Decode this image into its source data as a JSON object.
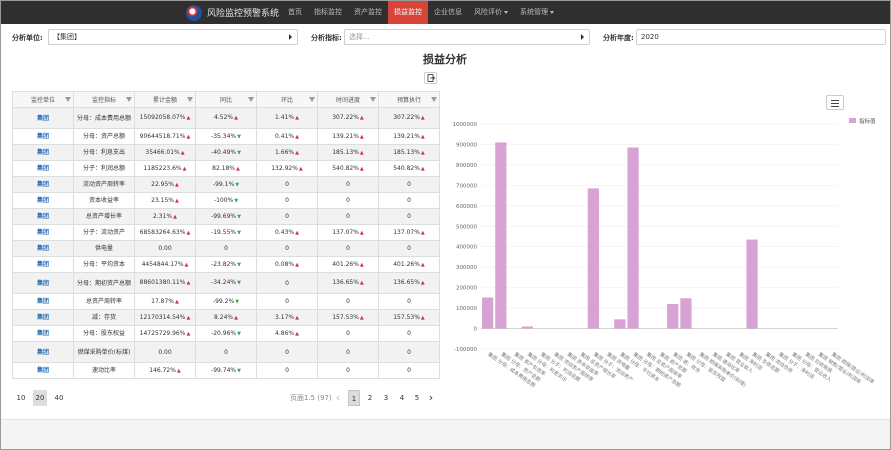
{
  "app": {
    "title": "风险监控预警系统",
    "nav": [
      {
        "label": "首页",
        "active": false,
        "dropdown": false
      },
      {
        "label": "指标监控",
        "active": false,
        "dropdown": false
      },
      {
        "label": "资产监控",
        "active": false,
        "dropdown": false
      },
      {
        "label": "损益监控",
        "active": true,
        "dropdown": false
      },
      {
        "label": "企业信息",
        "active": false,
        "dropdown": false
      },
      {
        "label": "风险评价",
        "active": false,
        "dropdown": true
      },
      {
        "label": "系统管理",
        "active": false,
        "dropdown": true
      }
    ],
    "accent_color": "#d6443a",
    "nav_bg_color": "#2f2f2f"
  },
  "filters": {
    "unit_label": "分析单位:",
    "unit_value": "【集团】",
    "indicator_label": "分析指标:",
    "indicator_placeholder": "选择...",
    "year_label": "分析年度:",
    "year_value": "2020"
  },
  "page": {
    "title": "损益分析",
    "export_icon": "export-icon"
  },
  "table": {
    "columns": [
      "监控单位",
      "监控指标",
      "累计金额",
      "同比",
      "环比",
      "时间进度",
      "预算执行"
    ],
    "rows": [
      {
        "unit": "集团",
        "indicator": "分母：成本费用总额",
        "amount": "15092058.07%",
        "amount_trend": "up",
        "yoy": "4.52%",
        "yoy_trend": "up",
        "mom": "1.41%",
        "mom_trend": "up",
        "progress": "307.22%",
        "progress_trend": "up",
        "budget": "307.22%",
        "budget_trend": "up"
      },
      {
        "unit": "集团",
        "indicator": "分母：资产总额",
        "amount": "90644518.71%",
        "amount_trend": "up",
        "yoy": "-35.34%",
        "yoy_trend": "down",
        "mom": "0.41%",
        "mom_trend": "up",
        "progress": "139.21%",
        "progress_trend": "up",
        "budget": "139.21%",
        "budget_trend": "up"
      },
      {
        "unit": "集团",
        "indicator": "分母：利息支出",
        "amount": "35466.01%",
        "amount_trend": "up",
        "yoy": "-40.49%",
        "yoy_trend": "down",
        "mom": "1.66%",
        "mom_trend": "up",
        "progress": "185.13%",
        "progress_trend": "up",
        "budget": "185.13%",
        "budget_trend": "up"
      },
      {
        "unit": "集团",
        "indicator": "分子：利润总额",
        "amount": "1185223.6%",
        "amount_trend": "up",
        "yoy": "82.18%",
        "yoy_trend": "up",
        "mom": "132.92%",
        "mom_trend": "up",
        "progress": "540.82%",
        "progress_trend": "up",
        "budget": "540.82%",
        "budget_trend": "up"
      },
      {
        "unit": "集团",
        "indicator": "流动资产周转率",
        "amount": "22.95%",
        "amount_trend": "up",
        "yoy": "-99.1%",
        "yoy_trend": "down",
        "mom": "0",
        "mom_trend": "",
        "progress": "0",
        "progress_trend": "",
        "budget": "0",
        "budget_trend": ""
      },
      {
        "unit": "集团",
        "indicator": "资本收益率",
        "amount": "23.15%",
        "amount_trend": "up",
        "yoy": "-100%",
        "yoy_trend": "down",
        "mom": "0",
        "mom_trend": "",
        "progress": "0",
        "progress_trend": "",
        "budget": "0",
        "budget_trend": ""
      },
      {
        "unit": "集团",
        "indicator": "总资产增长率",
        "amount": "2.31%",
        "amount_trend": "up",
        "yoy": "-99.69%",
        "yoy_trend": "down",
        "mom": "0",
        "mom_trend": "",
        "progress": "0",
        "progress_trend": "",
        "budget": "0",
        "budget_trend": ""
      },
      {
        "unit": "集团",
        "indicator": "分子：流动资产",
        "amount": "68583264.63%",
        "amount_trend": "up",
        "yoy": "-19.55%",
        "yoy_trend": "down",
        "mom": "0.43%",
        "mom_trend": "up",
        "progress": "137.07%",
        "progress_trend": "up",
        "budget": "137.07%",
        "budget_trend": "up"
      },
      {
        "unit": "集团",
        "indicator": "供电量",
        "amount": "0.00",
        "amount_trend": "",
        "yoy": "0",
        "yoy_trend": "",
        "mom": "0",
        "mom_trend": "",
        "progress": "0",
        "progress_trend": "",
        "budget": "0",
        "budget_trend": ""
      },
      {
        "unit": "集团",
        "indicator": "分母：平均资本",
        "amount": "4454844.17%",
        "amount_trend": "up",
        "yoy": "-23.82%",
        "yoy_trend": "down",
        "mom": "0.08%",
        "mom_trend": "up",
        "progress": "401.26%",
        "progress_trend": "up",
        "budget": "401.26%",
        "budget_trend": "up"
      },
      {
        "unit": "集团",
        "indicator": "分母：期初资产总额",
        "amount": "88601380.11%",
        "amount_trend": "up",
        "yoy": "-34.24%",
        "yoy_trend": "down",
        "mom": "0",
        "mom_trend": "",
        "progress": "136.65%",
        "progress_trend": "up",
        "budget": "136.65%",
        "budget_trend": "up"
      },
      {
        "unit": "集团",
        "indicator": "总资产周转率",
        "amount": "17.87%",
        "amount_trend": "up",
        "yoy": "-99.2%",
        "yoy_trend": "down",
        "mom": "0",
        "mom_trend": "",
        "progress": "0",
        "progress_trend": "",
        "budget": "0",
        "budget_trend": ""
      },
      {
        "unit": "集团",
        "indicator": "减：存货",
        "amount": "12170314.54%",
        "amount_trend": "up",
        "yoy": "8.24%",
        "yoy_trend": "up",
        "mom": "3.17%",
        "mom_trend": "up",
        "progress": "157.53%",
        "progress_trend": "up",
        "budget": "157.53%",
        "budget_trend": "up"
      },
      {
        "unit": "集团",
        "indicator": "分母：股东权益",
        "amount": "14725729.96%",
        "amount_trend": "up",
        "yoy": "-20.96%",
        "yoy_trend": "down",
        "mom": "4.86%",
        "mom_trend": "up",
        "progress": "0",
        "progress_trend": "",
        "budget": "0",
        "budget_trend": ""
      },
      {
        "unit": "集团",
        "indicator": "燃煤采购单价(标煤)",
        "amount": "0.00",
        "amount_trend": "",
        "yoy": "0",
        "yoy_trend": "",
        "mom": "0",
        "mom_trend": "",
        "progress": "0",
        "progress_trend": "",
        "budget": "0",
        "budget_trend": ""
      },
      {
        "unit": "集团",
        "indicator": "速动比率",
        "amount": "146.72%",
        "amount_trend": "up",
        "yoy": "-99.74%",
        "yoy_trend": "down",
        "mom": "0",
        "mom_trend": "",
        "progress": "0",
        "progress_trend": "",
        "budget": "0",
        "budget_trend": ""
      }
    ],
    "row_heights": null
  },
  "pagination": {
    "page_sizes": [
      "10",
      "20",
      "40"
    ],
    "active_page_size": "20",
    "info": "页面1.5 (97)",
    "pages": [
      "1",
      "2",
      "3",
      "4",
      "5"
    ],
    "active_page": "1",
    "prev_icon": "chevron-left-icon",
    "next_icon": "chevron-right-icon"
  },
  "chart_menu_icon": "hamburger-menu-icon",
  "chart_data": {
    "type": "bar",
    "title": "",
    "xlabel": "",
    "ylabel": "",
    "legend": {
      "entries": [
        "指标值"
      ],
      "position": "top-right"
    },
    "bar_color": "#d7a3d5",
    "ylim": [
      -100000,
      1000000
    ],
    "yticks": [
      1000000,
      900000,
      800000,
      700000,
      600000,
      500000,
      400000,
      300000,
      200000,
      100000,
      0,
      -100000
    ],
    "grid": true,
    "series": [
      {
        "name": "指标值",
        "values": [
          152000,
          910000,
          0,
          10000,
          0,
          0,
          0,
          0,
          685000,
          0,
          45000,
          885000,
          0,
          0,
          120000,
          148000,
          0,
          0,
          0,
          0,
          435000,
          0,
          0,
          0,
          0,
          0,
          0
        ]
      }
    ],
    "categories": [
      "集团 分母：成本费用总额",
      "集团 分母：资产总额",
      "集团 资产负债率",
      "集团 分母：利息支出",
      "集团 分子：利润总额",
      "集团 流动资产周转率",
      "集团 资本收益率",
      "集团 总资产增长率",
      "集团 分子：流动资产",
      "集团 供电量",
      "集团 分母：平均资本",
      "集团 分母：期初资产总额",
      "集团 总资产周转率",
      "集团 资产总额",
      "集团 减：存货",
      "集团 分母：股东权益",
      "集团 燃煤采购单价(标煤)",
      "集团 速动比率",
      "集团 营业收入",
      "集团 净利润",
      "集团 负债总额",
      "集团 流动负债",
      "集团 分子：净利润",
      "集团 分母：营业收入",
      "集团 应收账款",
      "集团 销售(营业)利润率",
      "集团 燃煤(营业)利润率"
    ]
  }
}
